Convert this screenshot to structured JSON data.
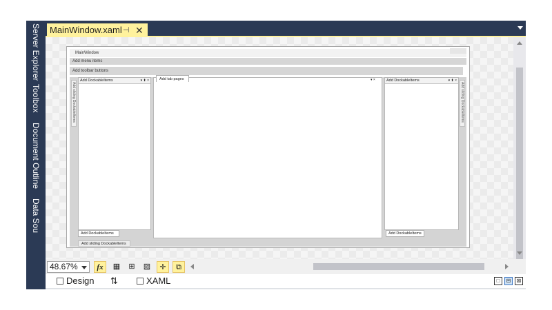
{
  "left_strip": {
    "tabs": [
      "Server Explorer",
      "Toolbox",
      "Document Outline",
      "Data Sou"
    ]
  },
  "document_tab": {
    "title": "MainWindow.xaml",
    "pin_glyph": "⊣",
    "close_glyph": "✕"
  },
  "window_preview": {
    "title": "MainWindow",
    "menu_text": "Add menu items",
    "toolbar_text": "Add toolbar buttons",
    "left_sliding": "Add sliding DockableItems",
    "right_sliding": "Add sliding DockableItems",
    "left_pane_header": "Add DockableItems",
    "right_pane_header": "Add DockableItems",
    "pane_controls": "▾ ⬍ ×",
    "center_tab": "Add tab pages",
    "center_controls": "▾ ×",
    "left_bottom_tab": "Add DockableItems",
    "right_bottom_tab": "Add DockableItems",
    "bottom_sliding": "Add sliding DockableItems"
  },
  "zoom_toolbar": {
    "zoom_value": "48.67%",
    "fx_label": "fx",
    "grid_glyph": "▦",
    "snap_glyph": "⊞",
    "checker_glyph": "▨",
    "snapline_glyph": "✛",
    "effects_glyph": "⧉"
  },
  "view_tabs": {
    "design_label": "Design",
    "swap_glyph": "⇅",
    "xaml_label": "XAML"
  },
  "pane_buttons": [
    "□",
    "⊟",
    "⊠"
  ],
  "colors": {
    "chrome": "#2b3a55",
    "active_tab": "#fff29d"
  }
}
